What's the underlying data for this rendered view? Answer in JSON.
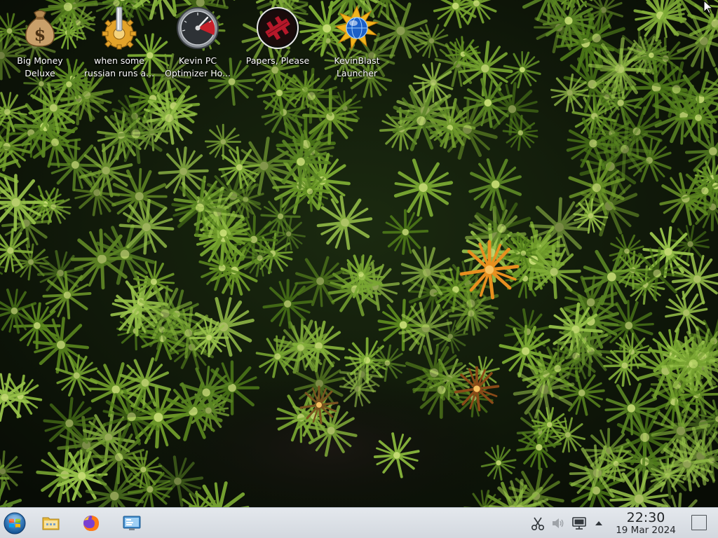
{
  "desktop": {
    "wallpaper": "green moss",
    "icons": [
      {
        "name": "big-money-deluxe",
        "label_line1": "Big Money",
        "label_line2": "Deluxe",
        "icon": "money-bag-icon"
      },
      {
        "name": "russian-runs",
        "label_line1": "when some",
        "label_line2": "russian runs a...",
        "icon": "gear-icon"
      },
      {
        "name": "kevin-pc-optimizer",
        "label_line1": "Kevin PC",
        "label_line2": "Optimizer Ho...",
        "icon": "speedometer-icon"
      },
      {
        "name": "papers-please",
        "label_line1": "Papers, Please",
        "label_line2": "",
        "icon": "papers-please-icon"
      },
      {
        "name": "kevinblast-launcher",
        "label_line1": "KevinBlast",
        "label_line2": "Launcher",
        "icon": "globe-burst-icon"
      }
    ]
  },
  "taskbar": {
    "start_icon": "start-orb-icon",
    "launchers": [
      "file-manager-icon",
      "firefox-icon",
      "system-settings-icon"
    ],
    "tray": [
      "clipboard-scissors-icon",
      "volume-icon",
      "display-icon",
      "tray-expand-arrow-icon"
    ],
    "clock": {
      "time": "22:30",
      "date": "19 Mar 2024"
    },
    "show_desktop": "show-desktop-icon"
  },
  "colors": {
    "taskbar_bg": "#dde2e8",
    "label_text": "#ffffff",
    "wallpaper_green": "#6f9a2a",
    "orange_plant": "#e8901f"
  }
}
